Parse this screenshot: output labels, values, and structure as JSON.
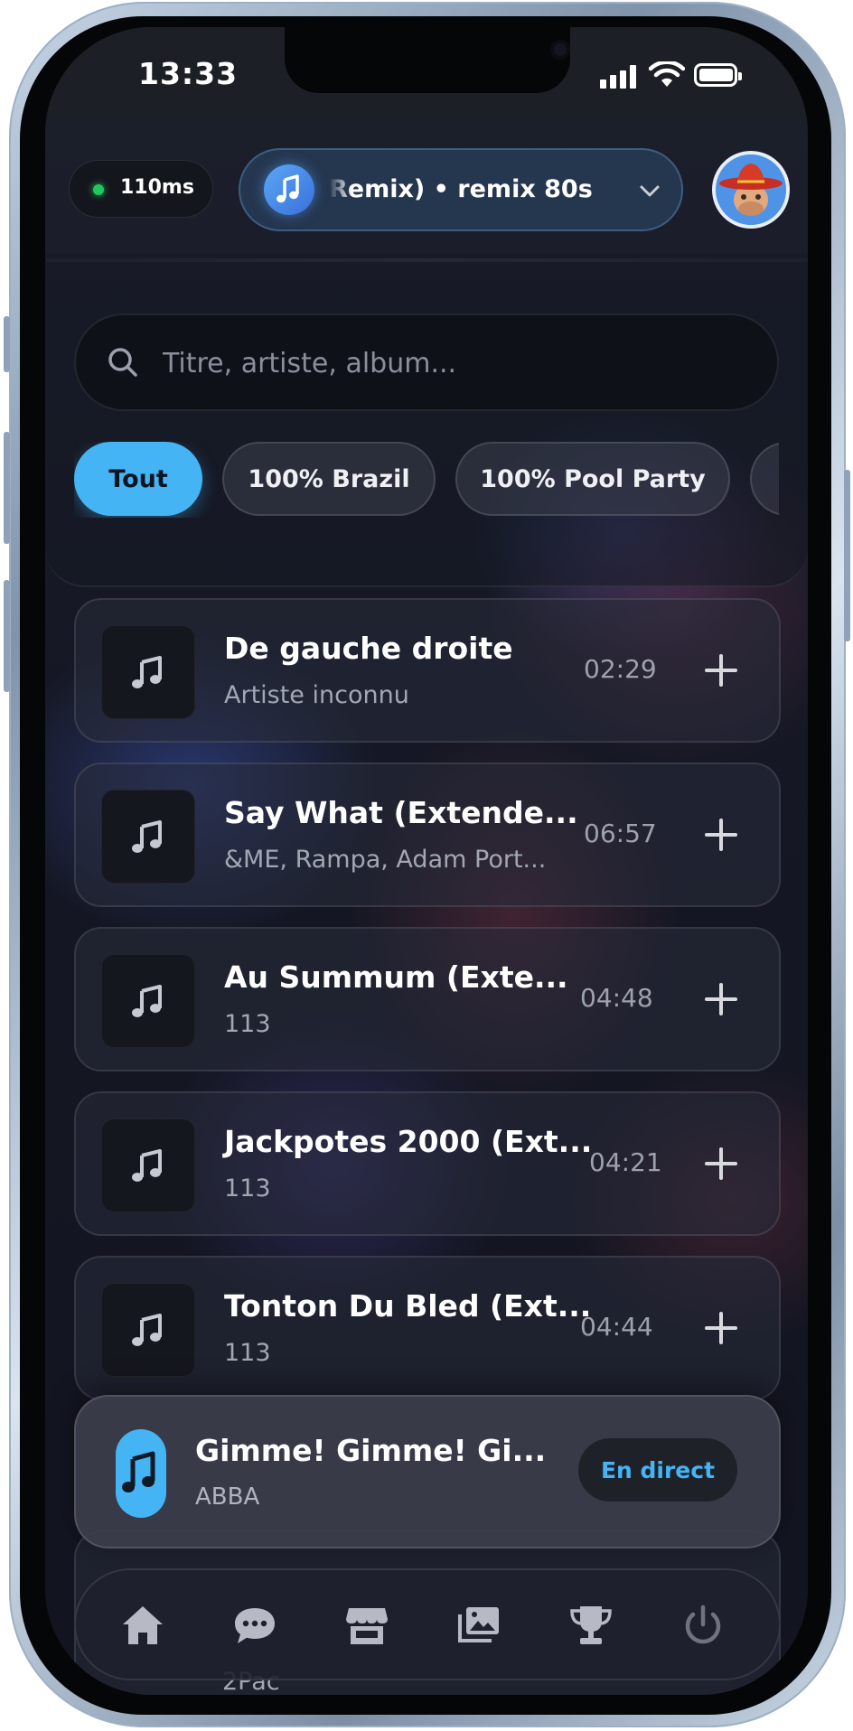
{
  "status_bar": {
    "time": "13:33"
  },
  "header": {
    "latency": "110ms",
    "latency_color": "#22c55e",
    "playlist": "Remix) • remix 80s"
  },
  "search": {
    "placeholder": "Titre, artiste, album..."
  },
  "filters": [
    {
      "label": "Tout",
      "active": true
    },
    {
      "label": "100% Brazil",
      "active": false
    },
    {
      "label": "100% Pool Party",
      "active": false
    }
  ],
  "tracks": [
    {
      "title": "De gauche droite",
      "artist": "Artiste inconnu",
      "duration": "02:29"
    },
    {
      "title": "Say What (Extende...",
      "artist": "&ME, Rampa, Adam Port...",
      "duration": "06:57"
    },
    {
      "title": "Au Summum (Exte...",
      "artist": "113",
      "duration": "04:48"
    },
    {
      "title": "Jackpotes 2000 (Ext...",
      "artist": "113",
      "duration": "04:21"
    },
    {
      "title": "Tonton Du Bled (Ext...",
      "artist": "113",
      "duration": "04:44"
    }
  ],
  "peek_track": {
    "artist": "2Pac"
  },
  "now_playing": {
    "title": "Gimme! Gimme! Gi...",
    "artist": "ABBA",
    "status_label": "En direct"
  },
  "nav": [
    "home-icon",
    "chat-icon",
    "store-icon",
    "gallery-icon",
    "trophy-icon",
    "power-icon"
  ],
  "colors": {
    "accent": "#45b4f4",
    "background": "#14161f"
  }
}
